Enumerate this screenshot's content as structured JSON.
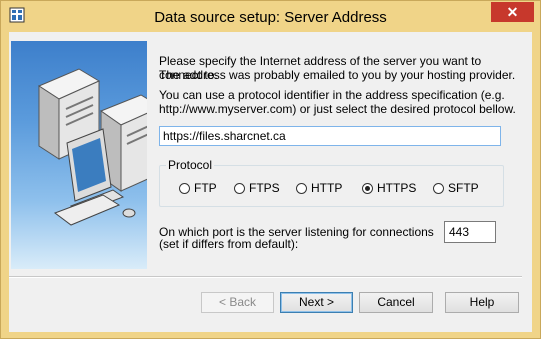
{
  "window": {
    "title": "Data source setup: Server Address",
    "close_label": "✕"
  },
  "intro": {
    "line1": "Please specify the Internet address of the server you want to connect to.",
    "line2": "The address was probably emailed to you by your hosting provider.",
    "line3": "You can use a protocol identifier in the address specification (e.g.",
    "line4": "http://www.myserver.com) or just select the desired protocol bellow."
  },
  "address": {
    "value": "https://files.sharcnet.ca"
  },
  "protocol": {
    "label": "Protocol",
    "options": [
      {
        "label": "FTP",
        "checked": false
      },
      {
        "label": "FTPS",
        "checked": false
      },
      {
        "label": "HTTP",
        "checked": false
      },
      {
        "label": "HTTPS",
        "checked": true
      },
      {
        "label": "SFTP",
        "checked": false
      }
    ]
  },
  "port": {
    "label_line1": "On which port is the server listening for connections",
    "label_line2": "(set if differs from default):",
    "value": "443"
  },
  "buttons": {
    "back": "< Back",
    "next": "Next >",
    "cancel": "Cancel",
    "help": "Help"
  },
  "colors": {
    "titlebar": "#f0d488",
    "close": "#c7382c",
    "focus_border": "#7eb4ea"
  }
}
